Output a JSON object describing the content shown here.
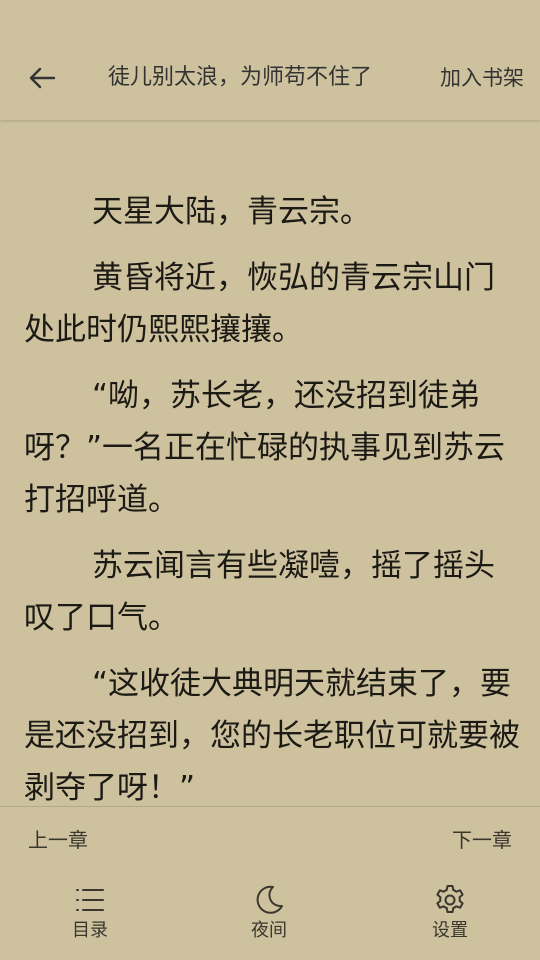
{
  "header": {
    "back_icon": "arrow-left-icon",
    "book_title": "徒儿别太浪，为师苟不住了",
    "add_to_shelf": "加入书架"
  },
  "content": {
    "paragraphs": [
      "天星大陆，青云宗。",
      "黄昏将近，恢弘的青云宗山门处此时仍熙熙攘攘。",
      "“呦，苏长老，还没招到徒弟呀？”一名正在忙碌的执事见到苏云打招呼道。",
      "苏云闻言有些凝噎，摇了摇头叹了口气。",
      "“这收徒大典明天就结束了，要是还没招到，您的长老职位可就要被剥夺了呀！”"
    ]
  },
  "chapter_nav": {
    "prev": "上一章",
    "next": "下一章"
  },
  "toolbar": {
    "toc_label": "目录",
    "toc_icon": "list-icon",
    "night_label": "夜间",
    "night_icon": "moon-icon",
    "settings_label": "设置",
    "settings_icon": "gear-icon"
  },
  "colors": {
    "background": "#cec29e",
    "text": "#1c1a15"
  }
}
